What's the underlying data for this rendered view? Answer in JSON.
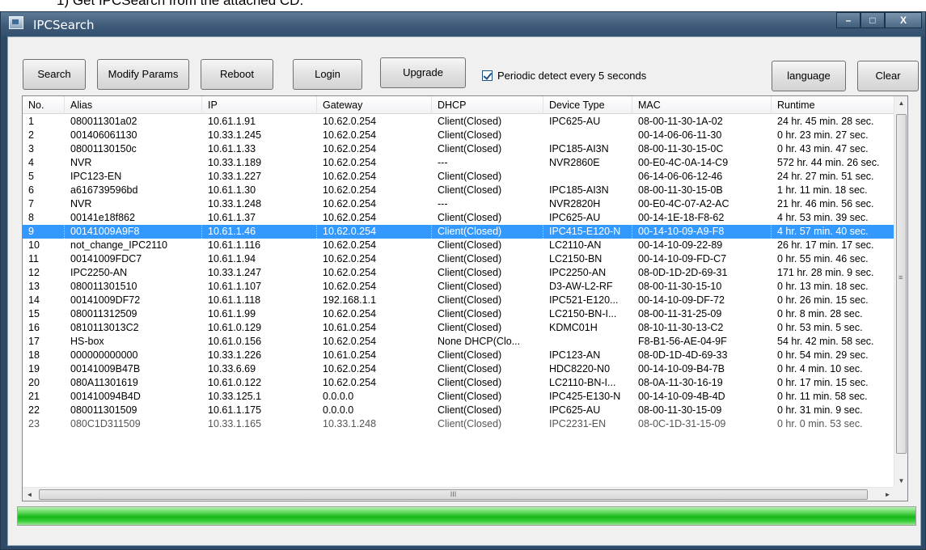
{
  "doc_caption": "1)      Get IPCSearch from the attached CD.",
  "window": {
    "title": "IPCSearch",
    "controls": {
      "minimize": "–",
      "maximize": "□",
      "close": "X"
    }
  },
  "toolbar": {
    "search": "Search",
    "modify_params": "Modify Params",
    "reboot": "Reboot",
    "login": "Login",
    "upgrade": "Upgrade",
    "periodic_label": "Periodic detect every 5 seconds",
    "periodic_checked": true,
    "language": "language",
    "clear": "Clear"
  },
  "table": {
    "columns": [
      "No.",
      "Alias",
      "IP",
      "Gateway",
      "DHCP",
      "Device Type",
      "MAC",
      "Runtime"
    ],
    "selected_row": 9,
    "rows": [
      [
        "1",
        "080011301a02",
        "10.61.1.91",
        "10.62.0.254",
        "Client(Closed)",
        "IPC625-AU",
        "08-00-11-30-1A-02",
        "24 hr. 45 min. 28 sec."
      ],
      [
        "2",
        "001406061130",
        "10.33.1.245",
        "10.62.0.254",
        "Client(Closed)",
        "",
        "00-14-06-06-11-30",
        "0 hr. 23 min. 27 sec."
      ],
      [
        "3",
        "08001130150c",
        "10.61.1.33",
        "10.62.0.254",
        "Client(Closed)",
        "IPC185-AI3N",
        "08-00-11-30-15-0C",
        "0 hr. 43 min. 47 sec."
      ],
      [
        "4",
        "NVR",
        "10.33.1.189",
        "10.62.0.254",
        "---",
        "NVR2860E",
        "00-E0-4C-0A-14-C9",
        "572 hr. 44 min. 26 sec."
      ],
      [
        "5",
        "IPC123-EN",
        "10.33.1.227",
        "10.62.0.254",
        "Client(Closed)",
        "",
        "06-14-06-06-12-46",
        "24 hr. 27 min. 51 sec."
      ],
      [
        "6",
        "a616739596bd",
        "10.61.1.30",
        "10.62.0.254",
        "Client(Closed)",
        "IPC185-AI3N",
        "08-00-11-30-15-0B",
        "1 hr. 11 min. 18 sec."
      ],
      [
        "7",
        "NVR",
        "10.33.1.248",
        "10.62.0.254",
        "---",
        "NVR2820H",
        "00-E0-4C-07-A2-AC",
        "21 hr. 46 min. 56 sec."
      ],
      [
        "8",
        "00141e18f862",
        "10.61.1.37",
        "10.62.0.254",
        "Client(Closed)",
        "IPC625-AU",
        "00-14-1E-18-F8-62",
        "4 hr. 53 min. 39 sec."
      ],
      [
        "9",
        "00141009A9F8",
        "10.61.1.46",
        "10.62.0.254",
        "Client(Closed)",
        "IPC415-E120-N",
        "00-14-10-09-A9-F8",
        "4 hr. 57 min. 40 sec."
      ],
      [
        "10",
        "not_change_IPC2110",
        "10.61.1.116",
        "10.62.0.254",
        "Client(Closed)",
        "LC2110-AN",
        "00-14-10-09-22-89",
        "26 hr. 17 min. 17 sec."
      ],
      [
        "11",
        "00141009FDC7",
        "10.61.1.94",
        "10.62.0.254",
        "Client(Closed)",
        "LC2150-BN",
        "00-14-10-09-FD-C7",
        "0 hr. 55 min. 46 sec."
      ],
      [
        "12",
        "IPC2250-AN",
        "10.33.1.247",
        "10.62.0.254",
        "Client(Closed)",
        "IPC2250-AN",
        "08-0D-1D-2D-69-31",
        "171 hr. 28 min. 9 sec."
      ],
      [
        "13",
        "080011301510",
        "10.61.1.107",
        "10.62.0.254",
        "Client(Closed)",
        "D3-AW-L2-RF",
        "08-00-11-30-15-10",
        "0 hr. 13 min. 18 sec."
      ],
      [
        "14",
        "00141009DF72",
        "10.61.1.118",
        "192.168.1.1",
        "Client(Closed)",
        "IPC521-E120...",
        "00-14-10-09-DF-72",
        "0 hr. 26 min. 15 sec."
      ],
      [
        "15",
        "080011312509",
        "10.61.1.99",
        "10.62.0.254",
        "Client(Closed)",
        "LC2150-BN-I...",
        "08-00-11-31-25-09",
        "0 hr. 8 min. 28 sec."
      ],
      [
        "16",
        "0810113013C2",
        "10.61.0.129",
        "10.61.0.254",
        "Client(Closed)",
        "KDMC01H",
        "08-10-11-30-13-C2",
        "0 hr. 53 min. 5 sec."
      ],
      [
        "17",
        "HS-box",
        "10.61.0.156",
        "10.62.0.254",
        "None DHCP(Clo...",
        "",
        "F8-B1-56-AE-04-9F",
        "54 hr. 42 min. 58 sec."
      ],
      [
        "18",
        "000000000000",
        "10.33.1.226",
        "10.61.0.254",
        "Client(Closed)",
        "IPC123-AN",
        "08-0D-1D-4D-69-33",
        "0 hr. 54 min. 29 sec."
      ],
      [
        "19",
        "00141009B47B",
        "10.33.6.69",
        "10.62.0.254",
        "Client(Closed)",
        "HDC8220-N0",
        "00-14-10-09-B4-7B",
        "0 hr. 4 min. 10 sec."
      ],
      [
        "20",
        "080A11301619",
        "10.61.0.122",
        "10.62.0.254",
        "Client(Closed)",
        "LC2110-BN-I...",
        "08-0A-11-30-16-19",
        "0 hr. 17 min. 15 sec."
      ],
      [
        "21",
        "001410094B4D",
        "10.33.125.1",
        "0.0.0.0",
        "Client(Closed)",
        "IPC425-E130-N",
        "00-14-10-09-4B-4D",
        "0 hr. 11 min. 58 sec."
      ],
      [
        "22",
        "080011301509",
        "10.61.1.175",
        "0.0.0.0",
        "Client(Closed)",
        "IPC625-AU",
        "08-00-11-30-15-09",
        "0 hr. 31 min. 9 sec."
      ],
      [
        "23",
        "080C1D311509",
        "10.33.1.165",
        "10.33.1.248",
        "Client(Closed)",
        "IPC2231-EN",
        "08-0C-1D-31-15-09",
        "0 hr. 0 min. 53 sec."
      ]
    ]
  },
  "scrollbars": {
    "up_arrow": "▲",
    "down_arrow": "▼",
    "left_arrow": "◄",
    "right_arrow": "►",
    "h_grip": "III",
    "v_grip": "≡"
  },
  "progress": {
    "value": 1.0,
    "color": "#16b619"
  },
  "colors": {
    "selection": "#3399ff",
    "titlebar": "#3c5a78"
  },
  "icons": {
    "app": "network-window-icon",
    "checkbox": "checkmark-icon"
  }
}
